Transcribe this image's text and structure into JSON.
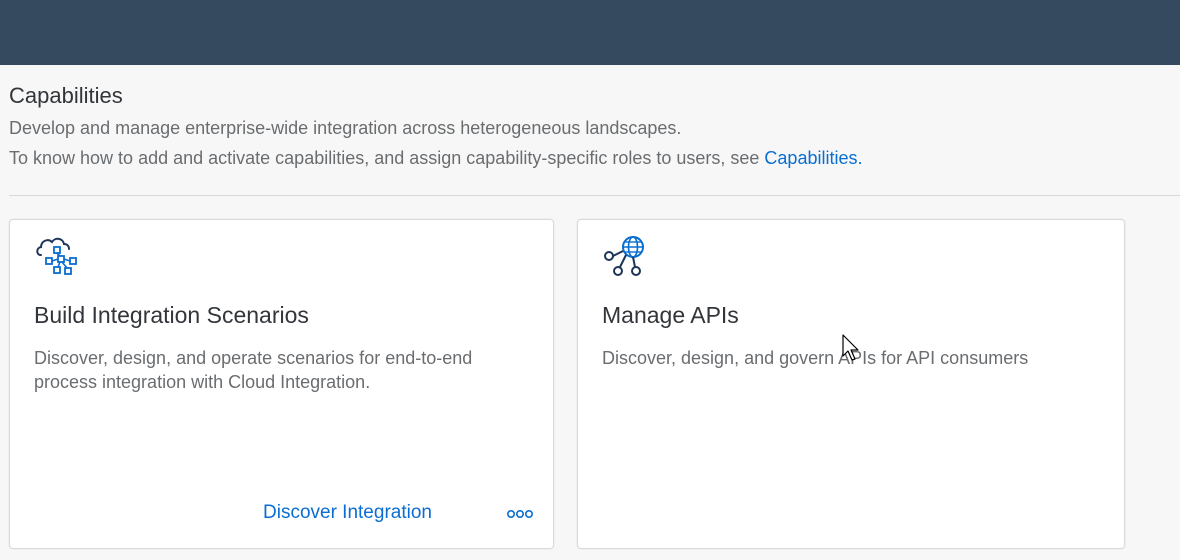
{
  "page": {
    "title": "Capabilities",
    "subtitle": "Develop and manage enterprise-wide integration across heterogeneous landscapes.",
    "info_prefix": "To know how to add and activate capabilities, and assign capability-specific roles to users, see ",
    "info_link": "Capabilities."
  },
  "cards": [
    {
      "icon": "cloud-network-icon",
      "title": "Build Integration Scenarios",
      "description": "Discover, design, and operate scenarios for end-to-end process integration with Cloud Integration.",
      "action_label": "Discover Integration",
      "more_icon": "more-options-icon"
    },
    {
      "icon": "api-globe-icon",
      "title": "Manage APIs",
      "description": "Discover, design, and govern APIs for API consumers"
    }
  ],
  "colors": {
    "shell": "#354a5f",
    "link": "#0a6ed1",
    "text_primary": "#32363a",
    "text_secondary": "#6a6d70",
    "icon_blue": "#0a6ed1",
    "icon_dark": "#1d3557"
  }
}
